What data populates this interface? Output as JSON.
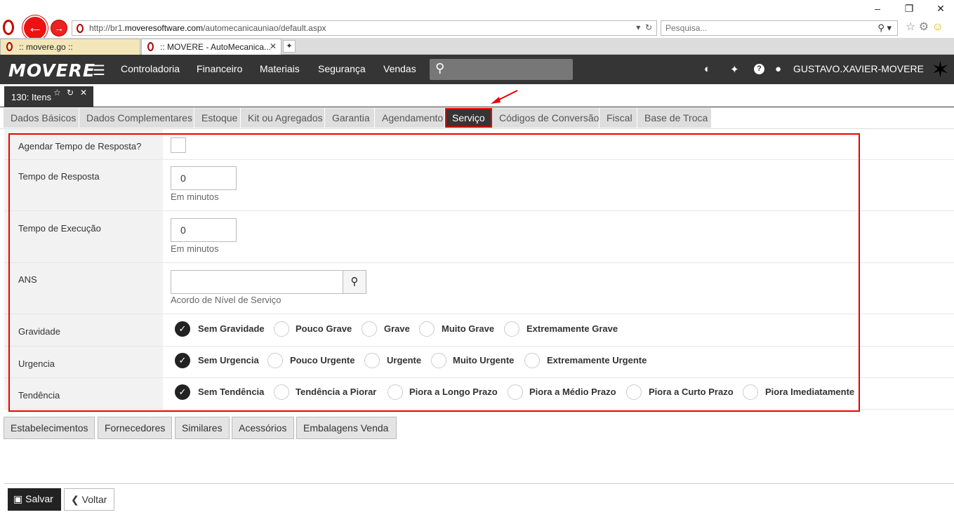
{
  "browser": {
    "url_prefix": "http://br1.",
    "url_domain": "moveresoftware.com",
    "url_path": "/automecanicauniao/default.aspx",
    "search_placeholder": "Pesquisa...",
    "tabs": [
      {
        "label": ":: movere.go ::"
      },
      {
        "label": ":: MOVERE - AutoMecanica..."
      }
    ]
  },
  "app": {
    "logo": "MOVERE",
    "menu": [
      "Controladoria",
      "Financeiro",
      "Materiais",
      "Segurança",
      "Vendas"
    ],
    "user": "GUSTAVO.XAVIER-MOVERE"
  },
  "page_tab": {
    "label": "130: Itens"
  },
  "subtabs": [
    "Dados Básicos",
    "Dados Complementares",
    "Estoque",
    "Kit ou Agregados",
    "Garantia",
    "Agendamento",
    "Serviço",
    "Códigos de Conversão",
    "Fiscal",
    "Base de Troca"
  ],
  "form": {
    "agendar": {
      "label": "Agendar Tempo de Resposta?"
    },
    "tempo_resposta": {
      "label": "Tempo de Resposta",
      "value": "0",
      "help": "Em minutos"
    },
    "tempo_execucao": {
      "label": "Tempo de Execução",
      "value": "0",
      "help": "Em minutos"
    },
    "ans": {
      "label": "ANS",
      "value": "",
      "help": "Acordo de Nível de Serviço"
    },
    "gravidade": {
      "label": "Gravidade",
      "options": [
        "Sem Gravidade",
        "Pouco Grave",
        "Grave",
        "Muito Grave",
        "Extremamente Grave"
      ],
      "selected": "Sem Gravidade"
    },
    "urgencia": {
      "label": "Urgencia",
      "options": [
        "Sem Urgencia",
        "Pouco Urgente",
        "Urgente",
        "Muito Urgente",
        "Extremamente Urgente"
      ],
      "selected": "Sem Urgencia"
    },
    "tendencia": {
      "label": "Tendência",
      "options": [
        "Sem Tendência",
        "Tendência a Piorar",
        "Piora a Longo Prazo",
        "Piora a Médio Prazo",
        "Piora a Curto Prazo",
        "Piora Imediatamente"
      ],
      "selected": "Sem Tendência"
    }
  },
  "bottom_tabs": [
    "Estabelecimentos",
    "Fornecedores",
    "Similares",
    "Acessórios",
    "Embalagens Venda"
  ],
  "actions": {
    "save": "Salvar",
    "back": "Voltar"
  },
  "colors": {
    "header_bg": "#353535",
    "highlight": "#e00000",
    "subtab_bg": "#dedede"
  }
}
